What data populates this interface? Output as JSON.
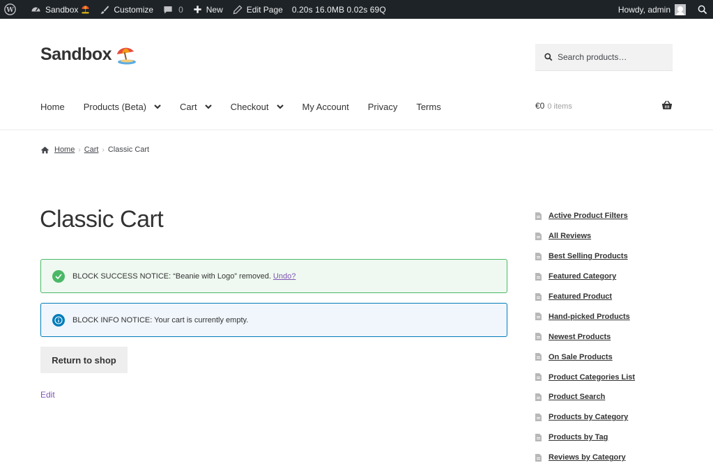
{
  "adminbar": {
    "site_name": "Sandbox",
    "customize": "Customize",
    "comments_count": "0",
    "new": "New",
    "edit_page": "Edit Page",
    "debug": "0.20s 16.0MB 0.02s 69Q",
    "howdy": "Howdy, admin"
  },
  "header": {
    "site_title": "Sandbox",
    "search_placeholder": "Search products…",
    "nav": [
      "Home",
      "Products (Beta)",
      "Cart",
      "Checkout",
      "My Account",
      "Privacy",
      "Terms"
    ],
    "cart_total": "€0",
    "cart_count": "0 items"
  },
  "breadcrumb": {
    "home": "Home",
    "cart": "Cart",
    "current": "Classic Cart"
  },
  "main": {
    "title": "Classic Cart",
    "success_notice": "BLOCK SUCCESS NOTICE: “Beanie with Logo” removed.",
    "success_link": "Undo?",
    "info_notice": "BLOCK INFO NOTICE: Your cart is currently empty.",
    "return_button": "Return to shop",
    "edit_link": "Edit"
  },
  "sidebar": {
    "items": [
      "Active Product Filters",
      "All Reviews",
      "Best Selling Products",
      "Featured Category",
      "Featured Product",
      "Hand-picked Products",
      "Newest Products",
      "On Sale Products",
      "Product Categories List",
      "Product Search",
      "Products by Category",
      "Products by Tag",
      "Reviews by Category"
    ]
  },
  "colors": {
    "adminbar_bg": "#1d2327",
    "accent_purple": "#7f54b3",
    "success": "#4ab866",
    "info": "#007cba"
  }
}
